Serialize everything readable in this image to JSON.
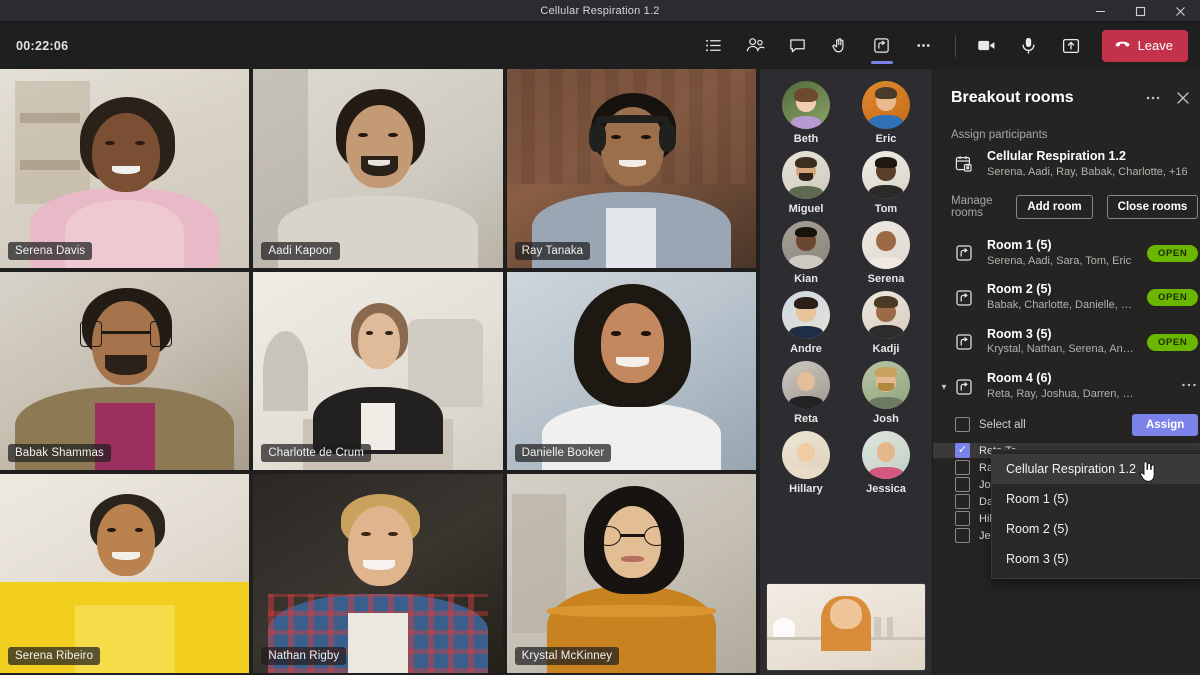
{
  "window": {
    "title": "Cellular Respiration 1.2",
    "minimize_label": "Minimize",
    "maximize_label": "Maximize",
    "close_label": "Close"
  },
  "toolbar": {
    "timer": "00:22:06",
    "icons": [
      {
        "name": "show-participants-list-icon",
        "label": "Show participants"
      },
      {
        "name": "people-icon",
        "label": "People"
      },
      {
        "name": "chat-icon",
        "label": "Show conversation"
      },
      {
        "name": "raise-hand-icon",
        "label": "Raise hand"
      },
      {
        "name": "breakout-rooms-icon",
        "label": "Breakout rooms"
      },
      {
        "name": "more-actions-icon",
        "label": "More actions"
      }
    ],
    "camera_label": "Camera",
    "mic_label": "Mic",
    "share_label": "Share content",
    "leave_label": "Leave"
  },
  "grid": {
    "tiles": [
      {
        "name": "Serena Davis"
      },
      {
        "name": "Aadi Kapoor"
      },
      {
        "name": "Ray Tanaka"
      },
      {
        "name": "Babak Shammas"
      },
      {
        "name": "Charlotte de Crum"
      },
      {
        "name": "Danielle Booker"
      },
      {
        "name": "Serena Ribeiro"
      },
      {
        "name": "Nathan Rigby"
      },
      {
        "name": "Krystal McKinney"
      }
    ]
  },
  "roster": {
    "participants": [
      {
        "name": "Beth"
      },
      {
        "name": "Eric"
      },
      {
        "name": "Miguel"
      },
      {
        "name": "Tom"
      },
      {
        "name": "Kian"
      },
      {
        "name": "Serena"
      },
      {
        "name": "Andre"
      },
      {
        "name": "Kadji"
      },
      {
        "name": "Reta"
      },
      {
        "name": "Josh"
      },
      {
        "name": "Hillary"
      },
      {
        "name": "Jessica"
      }
    ],
    "selfview_label": "Your video"
  },
  "panel": {
    "title": "Breakout rooms",
    "more_label": "More options",
    "close_label": "Close",
    "assign_participants_label": "Assign participants",
    "meeting": {
      "title": "Cellular Respiration 1.2",
      "subtitle": "Serena, Aadi, Ray, Babak, Charlotte, +16"
    },
    "manage_rooms_label": "Manage rooms",
    "add_room_label": "Add room",
    "close_rooms_label": "Close rooms",
    "rooms": [
      {
        "name": "Room 1 (5)",
        "members": "Serena, Aadi, Sara, Tom, Eric",
        "status": "OPEN",
        "expanded": false
      },
      {
        "name": "Room 2 (5)",
        "members": "Babak, Charlotte, Danielle, Mig...",
        "status": "OPEN",
        "expanded": false
      },
      {
        "name": "Room 3 (5)",
        "members": "Krystal, Nathan, Serena, Andre...",
        "status": "OPEN",
        "expanded": false
      },
      {
        "name": "Room 4 (6)",
        "members": "Reta, Ray, Joshua, Darren, Hilla...",
        "status": "",
        "expanded": true
      }
    ],
    "select_all_label": "Select all",
    "assign_label": "Assign",
    "room4_participants": [
      {
        "name": "Reta Ta",
        "checked": true
      },
      {
        "name": "Ray Tar",
        "checked": false
      },
      {
        "name": "Joshua",
        "checked": false
      },
      {
        "name": "Darren",
        "checked": false
      },
      {
        "name": "Hillary",
        "checked": false
      },
      {
        "name": "Jessica",
        "checked": false
      }
    ],
    "context_menu": {
      "items": [
        {
          "label": "Cellular Respiration 1.2",
          "hover": true
        },
        {
          "label": "Room 1 (5)",
          "hover": false
        },
        {
          "label": "Room 2 (5)",
          "hover": false
        },
        {
          "label": "Room 3 (5)",
          "hover": false
        }
      ]
    }
  },
  "colors": {
    "accent_purple": "#7b83eb",
    "leave_red": "#c4314b",
    "open_green": "#6bb700",
    "panel_bg": "#252423",
    "app_bg": "#1f1f1f"
  }
}
